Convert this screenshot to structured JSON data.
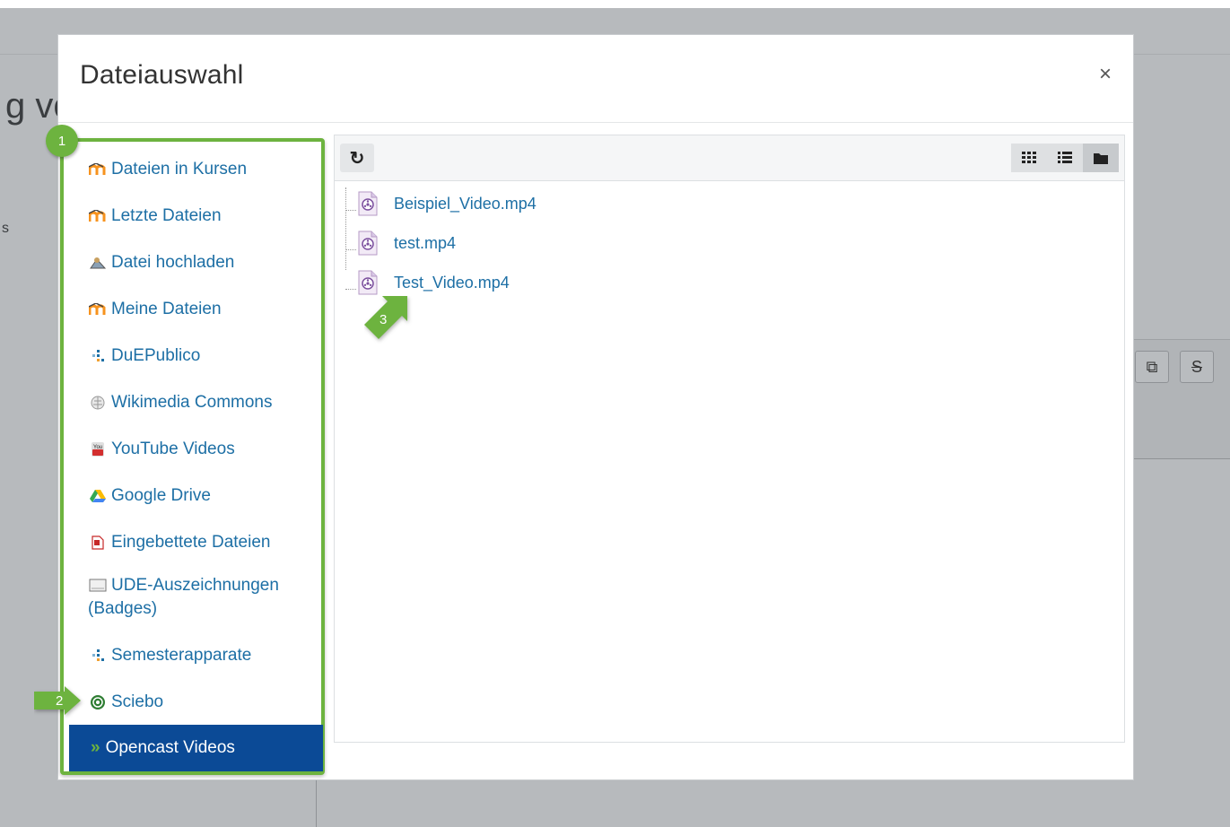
{
  "background": {
    "heading_fragment": "g vc",
    "side_fragment": "s",
    "editor_buttons": [
      "⧉",
      "S"
    ]
  },
  "modal": {
    "title": "Dateiauswahl",
    "close_label": "×"
  },
  "sidebar": {
    "items": [
      {
        "label": "Dateien in Kursen",
        "icon": "moodle-icon"
      },
      {
        "label": "Letzte Dateien",
        "icon": "moodle-icon"
      },
      {
        "label": "Datei hochladen",
        "icon": "upload-icon"
      },
      {
        "label": "Meine Dateien",
        "icon": "moodle-icon"
      },
      {
        "label": "DuEPublico",
        "icon": "duepublico-icon"
      },
      {
        "label": "Wikimedia Commons",
        "icon": "wikimedia-icon"
      },
      {
        "label": "YouTube Videos",
        "icon": "youtube-icon"
      },
      {
        "label": "Google Drive",
        "icon": "google-drive-icon"
      },
      {
        "label": "Eingebettete Dateien",
        "icon": "embedded-file-icon"
      },
      {
        "label": "UDE-Auszeichnungen",
        "label2": "(Badges)",
        "icon": "badge-icon"
      },
      {
        "label": "Semesterapparate",
        "icon": "duepublico-icon"
      },
      {
        "label": "Sciebo",
        "icon": "sciebo-icon"
      }
    ],
    "active": {
      "chevron": "»",
      "label": "Opencast Videos"
    }
  },
  "annotations": {
    "badge1": "1",
    "badge2": "2",
    "badge3": "3"
  },
  "files": [
    {
      "name": "Beispiel_Video.mp4"
    },
    {
      "name": "test.mp4"
    },
    {
      "name": "Test_Video.mp4"
    }
  ],
  "toolbar": {
    "refresh_icon": "refresh-icon",
    "views": [
      "icons-view-icon",
      "list-view-icon",
      "tree-view-icon"
    ]
  },
  "colors": {
    "accent_green": "#6db33f",
    "active_blue": "#0b4a96",
    "link_blue": "#1d6fa5"
  }
}
